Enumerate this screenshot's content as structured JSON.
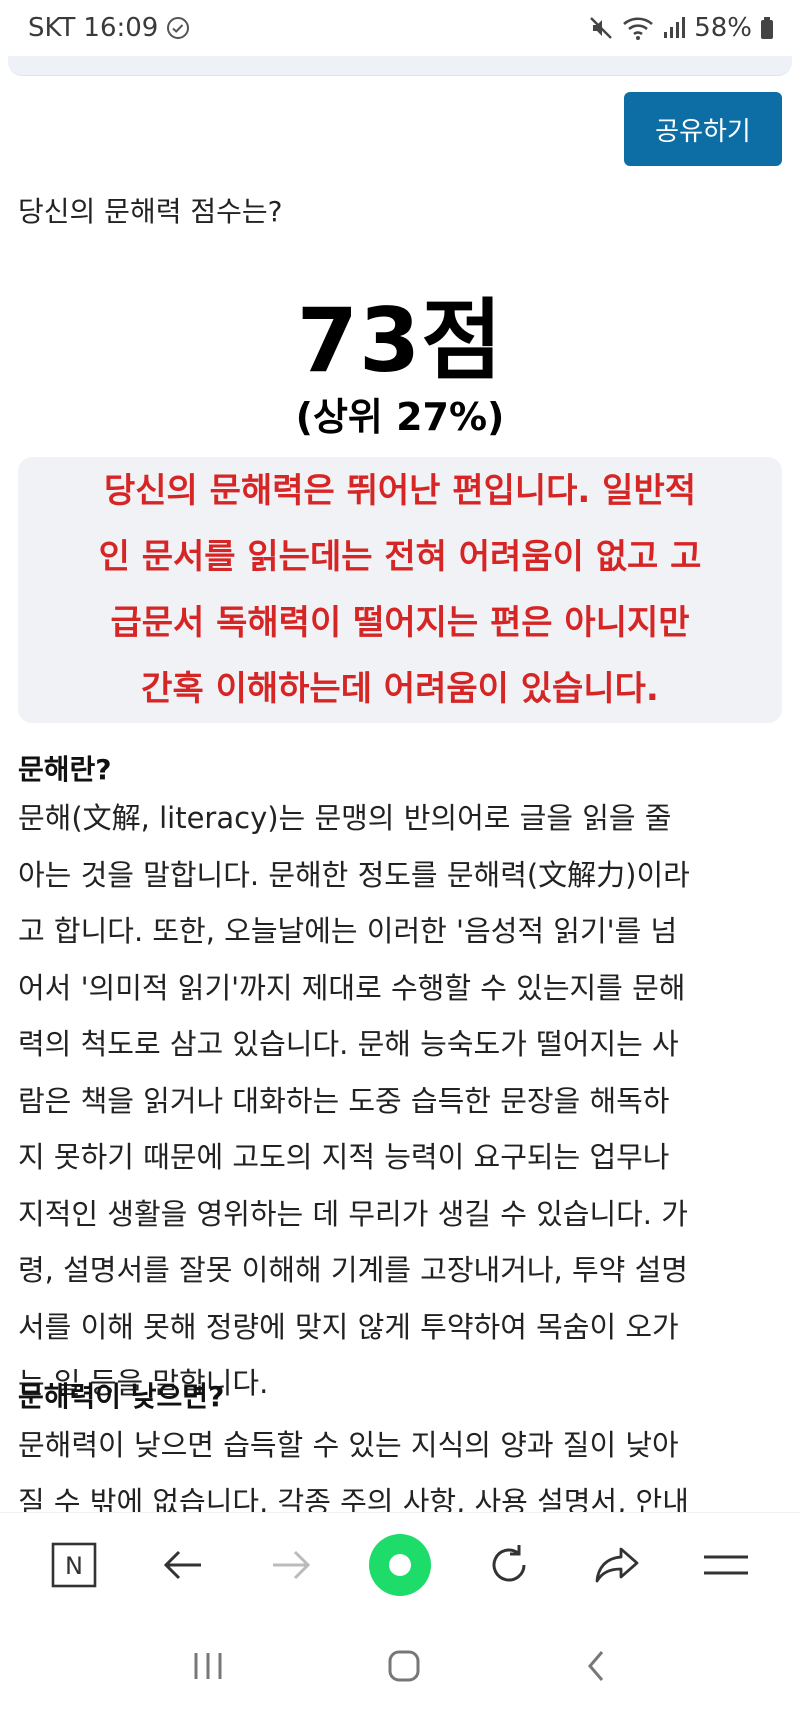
{
  "status_bar": {
    "carrier": "SKT",
    "time": "16:09",
    "battery": "58%"
  },
  "share_button": "공유하기",
  "question": "당신의 문해력 점수는?",
  "score": "73점",
  "rank": "(상위 27%)",
  "result_lines": [
    "당신의 문해력은 뛰어난 편입니다. 일반적",
    "인 문서를 읽는데는 전혀 어려움이 없고 고",
    "급문서 독해력이 떨어지는 편은 아니지만",
    "간혹 이해하는데 어려움이 있습니다."
  ],
  "sections": [
    {
      "title": "문해란?",
      "lines": [
        "문해(文解, literacy)는 문맹의 반의어로 글을 읽을 줄",
        "아는 것을 말합니다. 문해한 정도를 문해력(文解力)이라",
        "고 합니다. 또한, 오늘날에는 이러한 '음성적 읽기'를 넘",
        "어서 '의미적 읽기'까지 제대로 수행할 수 있는지를 문해",
        "력의 척도로 삼고 있습니다. 문해 능숙도가 떨어지는 사",
        "람은 책을 읽거나 대화하는 도중 습득한 문장을 해독하",
        "지 못하기 때문에 고도의 지적 능력이 요구되는 업무나",
        "지적인 생활을 영위하는 데 무리가 생길 수 있습니다. 가",
        "령, 설명서를 잘못 이해해 기계를 고장내거나, 투약 설명",
        "서를 이해 못해 정량에 맞지 않게 투약하여 목숨이 오가",
        "는 일 등을 말합니다."
      ]
    },
    {
      "title": "문해력이 낮으면?",
      "lines": [
        "문해력이 낮으면 습득할 수 있는 지식의 양과 질이 낮아",
        "질 수 밖에 없습니다. 각종 주의 사항, 사용 설명서, 안내"
      ]
    }
  ],
  "toolbar": {
    "n_label": "N"
  },
  "colors": {
    "share_button": "#0d6ea6",
    "result_text": "#d62525",
    "result_box": "#f0f2f6",
    "home_button": "#1edc6a"
  },
  "icons": [
    "check-circle-icon",
    "mute-icon",
    "wifi-icon",
    "signal-icon",
    "battery-icon",
    "naver-n-icon",
    "back-arrow-icon",
    "forward-arrow-icon",
    "home-icon",
    "refresh-icon",
    "share-arrow-icon",
    "menu-icon",
    "recent-apps-icon",
    "home-nav-icon",
    "back-nav-icon"
  ]
}
